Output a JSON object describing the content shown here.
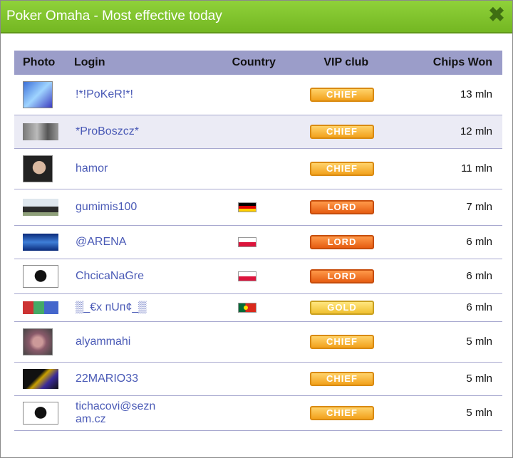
{
  "window": {
    "title": "Poker Omaha - Most effective today",
    "close_glyph": "✖"
  },
  "headers": {
    "photo": "Photo",
    "login": "Login",
    "country": "Country",
    "vip": "VIP club",
    "chips": "Chips Won"
  },
  "rows": [
    {
      "login": "!*!PoKeR!*!",
      "country": "",
      "vip": "CHIEF",
      "chips": "13 mln"
    },
    {
      "login": "*ProBoszcz*",
      "country": "",
      "vip": "CHIEF",
      "chips": "12 mln"
    },
    {
      "login": "hamor",
      "country": "",
      "vip": "CHIEF",
      "chips": "11 mln"
    },
    {
      "login": "gumimis100",
      "country": "de",
      "vip": "LORD",
      "chips": "7 mln"
    },
    {
      "login": "@ARENA",
      "country": "pl",
      "vip": "LORD",
      "chips": "6 mln"
    },
    {
      "login": "ChcicaNaGre",
      "country": "pl",
      "vip": "LORD",
      "chips": "6 mln"
    },
    {
      "login": "▒_€x пUп¢_▒",
      "country": "pt",
      "vip": "GOLD",
      "chips": "6 mln"
    },
    {
      "login": "alyammahi",
      "country": "",
      "vip": "CHIEF",
      "chips": "5 mln"
    },
    {
      "login": "22MARIO33",
      "country": "",
      "vip": "CHIEF",
      "chips": "5 mln"
    },
    {
      "login": "tichacovi@sezn",
      "login2": "am.cz",
      "country": "",
      "vip": "CHIEF",
      "chips": "5 mln"
    }
  ],
  "colors": {
    "titlebar": "#7bbd26",
    "header_row": "#9b9dc9",
    "login_link": "#4a5ab6"
  }
}
